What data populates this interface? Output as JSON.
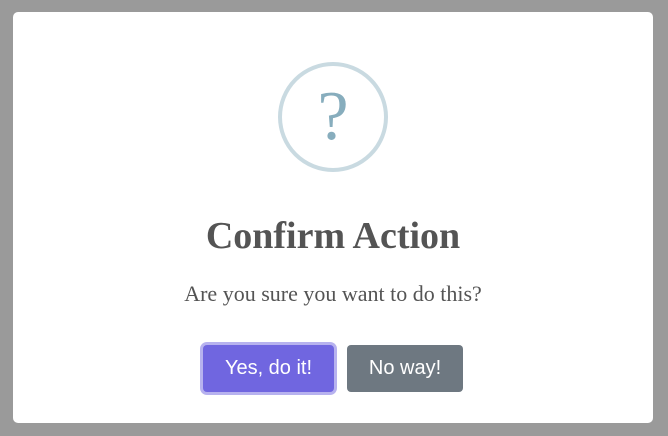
{
  "dialog": {
    "icon": {
      "name": "question-icon",
      "glyph": "?",
      "ring_color": "#c9dae1",
      "glyph_color": "#87adbd"
    },
    "title": "Confirm Action",
    "message": "Are you sure you want to do this?",
    "buttons": {
      "confirm_label": "Yes, do it!",
      "cancel_label": "No way!"
    }
  },
  "colors": {
    "overlay": "#9a9a9a",
    "confirm_button": "#7066e0",
    "cancel_button": "#6e7881",
    "text": "#545454"
  }
}
